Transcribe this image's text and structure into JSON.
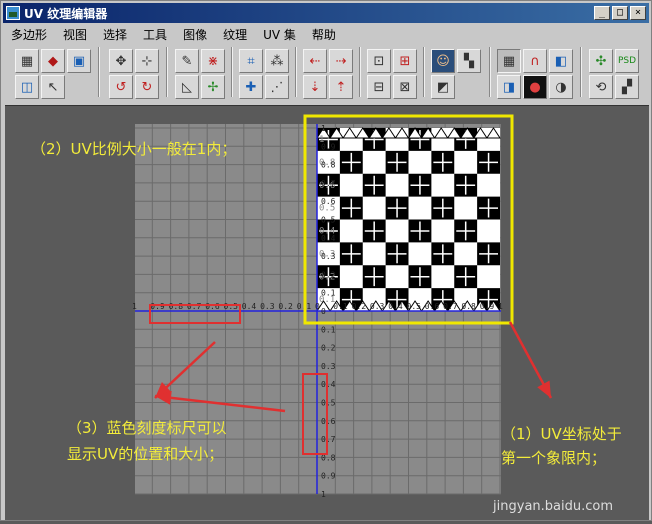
{
  "window": {
    "title": "UV 纹理编辑器",
    "controls": {
      "minimize": "_",
      "maximize": "□",
      "close": "×"
    }
  },
  "menu": [
    "多边形",
    "视图",
    "选择",
    "工具",
    "图像",
    "纹理",
    "UV 集",
    "帮助"
  ],
  "toolbar_icons": [
    "uv-flip-icon",
    "move-uv-icon",
    "select-uv-icon",
    "cut-uv-icon",
    "sew-uv-icon",
    "rotate-ccw-icon",
    "rotate-cw-icon",
    "grid-snap-icon",
    "unfold-icon",
    "layout-icon",
    "straighten-icon",
    "align-left-icon",
    "align-right-icon",
    "relax-icon",
    "map-icon",
    "texture-display-icon",
    "checker-icon",
    "pixel-snap-icon",
    "magnet-icon",
    "shaded-icon",
    "color-wheel-icon",
    "contrast-icon",
    "image-icon",
    "psd-icon",
    "refresh-icon",
    "checker-filter-icon"
  ],
  "canvas": {
    "colors": {
      "grid_bg": "#8a8a8a",
      "grid_line": "#6b6b6b",
      "axis": "#2222dd",
      "highlight_box": "#f0e800",
      "red_box": "#e03030"
    },
    "v_ticks": [
      "1",
      "0.9",
      "0.8",
      "0.7",
      "0.6",
      "0.5",
      "0.4",
      "0.3",
      "0.2",
      "0.1",
      "0",
      "0.1",
      "0.2",
      "0.3",
      "0.4",
      "0.5",
      "0.6",
      "0.7",
      "0.8",
      "0.9",
      "1"
    ],
    "h_ticks": [
      "1",
      "0.9",
      "0.8",
      "0.7",
      "0.6",
      "0.5",
      "0.4",
      "0.3",
      "0.2",
      "0.1",
      "0",
      "0.1",
      "0.2",
      "0.3",
      "0.4",
      "0.5",
      "0.6",
      "0.7",
      "0.8",
      "0.9",
      "1"
    ],
    "checker_labels": [
      "1",
      "0.8",
      "0.6",
      "0.5",
      "0.4",
      "0.3",
      "0.2",
      "0.1"
    ]
  },
  "annotations": {
    "note2": "（2）UV比例大小一般在1内；",
    "note3_line1": "（3）蓝色刻度标尺可以",
    "note3_line2": "显示UV的位置和大小；",
    "note1_line1": "（1）UV坐标处于",
    "note1_line2": "第一个象限内；"
  },
  "watermark": "jingyan.baidu.com"
}
